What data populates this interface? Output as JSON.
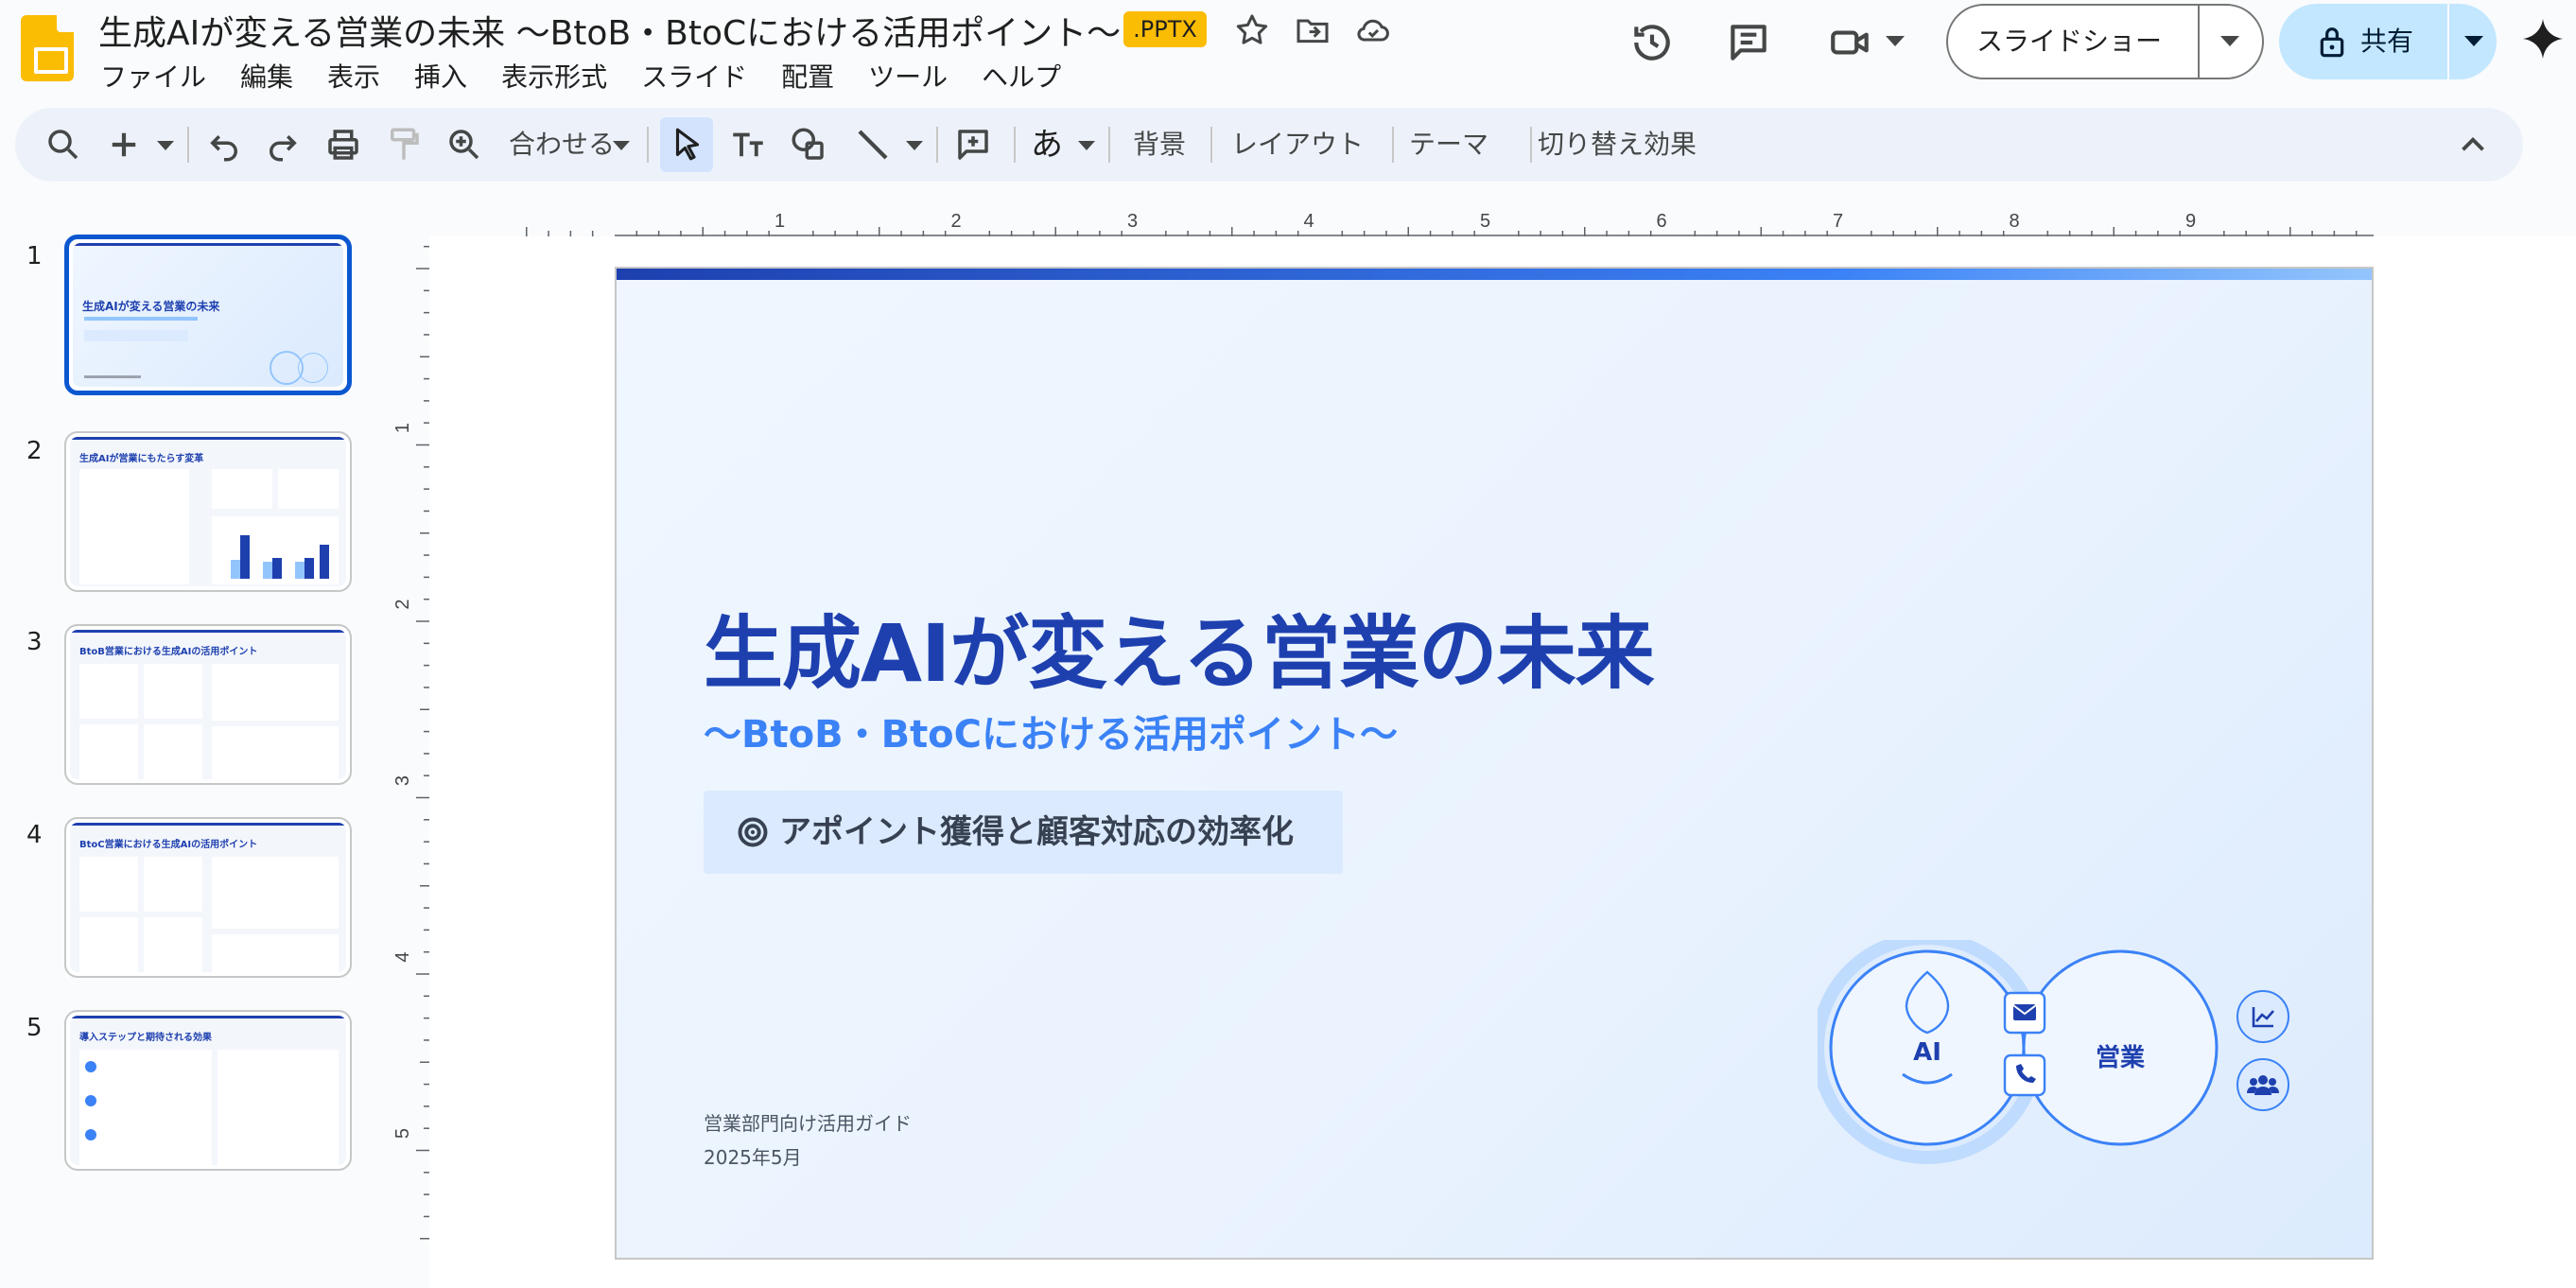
{
  "header": {
    "doc_title": "生成AIが変える営業の未来 〜BtoB・BtoCにおける活用ポイント〜",
    "file_badge": ".PPTX",
    "menu": [
      "ファイル",
      "編集",
      "表示",
      "挿入",
      "表示形式",
      "スライド",
      "配置",
      "ツール",
      "ヘルプ"
    ],
    "slideshow_label": "スライドショー",
    "share_label": "共有",
    "accent_color": "#0b57d0"
  },
  "toolbar": {
    "zoom_label": "合わせる",
    "background_label": "背景",
    "layout_label": "レイアウト",
    "theme_label": "テーマ",
    "transition_label": "切り替え効果",
    "input_glyph": "あ"
  },
  "filmstrip": {
    "active_index": 1,
    "slides": [
      {
        "number": "1",
        "title": "生成AIが変える営業の未来"
      },
      {
        "number": "2",
        "title": "生成AIが営業にもたらす変革"
      },
      {
        "number": "3",
        "title": "BtoB営業における生成AIの活用ポイント"
      },
      {
        "number": "4",
        "title": "BtoC営業における生成AIの活用ポイント"
      },
      {
        "number": "5",
        "title": "導入ステップと期待される効果"
      }
    ]
  },
  "rulers": {
    "horizontal": [
      "1",
      "2",
      "3",
      "4",
      "5",
      "6",
      "7",
      "8",
      "9"
    ],
    "vertical": [
      "1",
      "2",
      "3",
      "4",
      "5"
    ]
  },
  "slide": {
    "title": "生成AIが変える営業の未来",
    "subtitle": "〜BtoB・BtoCにおける活用ポイント〜",
    "pill_text": "アポイント獲得と顧客対応の効率化",
    "footer_line1": "営業部門向け活用ガイド",
    "footer_line2": "2025年5月",
    "diagram": {
      "left_label": "AI",
      "right_label": "営業"
    },
    "colors": {
      "primary": "#1e40af",
      "secondary": "#3b82f6",
      "pill_bg": "#dbeafe"
    }
  }
}
